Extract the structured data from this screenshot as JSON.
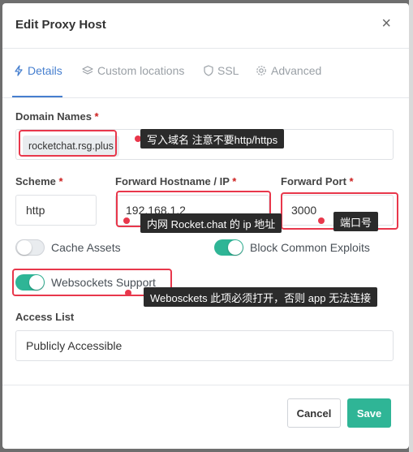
{
  "modal": {
    "title": "Edit Proxy Host",
    "close_icon": "×"
  },
  "tabs": [
    {
      "label": "Details",
      "icon": "bolt-icon",
      "active": true
    },
    {
      "label": "Custom locations",
      "icon": "layers-icon",
      "active": false
    },
    {
      "label": "SSL",
      "icon": "shield-icon",
      "active": false
    },
    {
      "label": "Advanced",
      "icon": "gear-icon",
      "active": false
    }
  ],
  "form": {
    "domain_names_label": "Domain Names",
    "domain_chip": "rocketchat.rsg.plus",
    "scheme_label": "Scheme",
    "scheme_value": "http",
    "forward_host_label": "Forward Hostname / IP",
    "forward_host_value": "192.168.1.2",
    "forward_port_label": "Forward Port",
    "forward_port_value": "3000",
    "required_mark": "*",
    "cache_assets_label": "Cache Assets",
    "cache_assets_on": false,
    "block_exploits_label": "Block Common Exploits",
    "block_exploits_on": true,
    "websockets_label": "Websockets Support",
    "websockets_on": true,
    "access_list_label": "Access List",
    "access_list_value": "Publicly Accessible"
  },
  "footer": {
    "cancel_label": "Cancel",
    "save_label": "Save"
  },
  "annotations": {
    "domain_tip": "写入域名 注意不要http/https",
    "host_tip": "内网 Rocket.chat 的 ip 地址",
    "port_tip": "端口号",
    "websockets_tip": "Webosckets 此项必须打开，否则 app 无法连接"
  },
  "colors": {
    "accent": "#467fcf",
    "toggle_on": "#2fb596",
    "save_button": "#2fb596",
    "annotation_red": "#e8374b",
    "required_red": "#cd201f"
  }
}
